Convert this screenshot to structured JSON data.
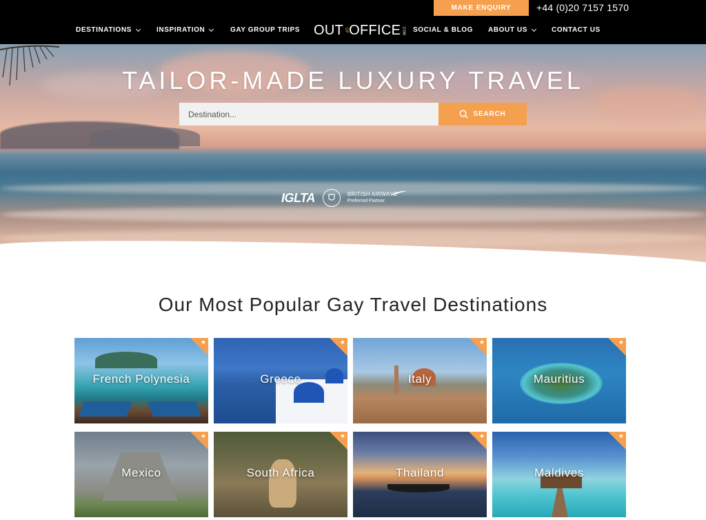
{
  "topbar": {
    "enquiry_label": "MAKE ENQUIRY",
    "phone": "+44 (0)20 7157 1570"
  },
  "nav": {
    "items": [
      {
        "label": "DESTINATIONS",
        "dropdown": true
      },
      {
        "label": "INSPIRATION",
        "dropdown": true
      },
      {
        "label": "GAY GROUP TRIPS",
        "dropdown": false
      },
      {
        "label": "SOCIAL & BLOG",
        "dropdown": false
      },
      {
        "label": "ABOUT US",
        "dropdown": true
      },
      {
        "label": "CONTACT US",
        "dropdown": false
      }
    ],
    "logo": {
      "left": "OUT",
      "middle": "OF",
      "right": "OFFICE",
      "suffix": ".COM"
    }
  },
  "hero": {
    "title": "TAILOR-MADE LUXURY TRAVEL",
    "search": {
      "placeholder": "Destination...",
      "button_label": "SEARCH",
      "button_icon": "search-icon"
    },
    "partners": {
      "iglta": "IGLTA",
      "ba_name": "BRITISH AIRWAYS",
      "ba_sub": "Preferred Partner"
    }
  },
  "section": {
    "title": "Our Most Popular Gay Travel Destinations"
  },
  "destinations": [
    {
      "name": "French Polynesia"
    },
    {
      "name": "Greece"
    },
    {
      "name": "Italy"
    },
    {
      "name": "Mauritius"
    },
    {
      "name": "Mexico"
    },
    {
      "name": "South Africa"
    },
    {
      "name": "Thailand"
    },
    {
      "name": "Maldives"
    }
  ],
  "colors": {
    "accent": "#f5a04e",
    "nav_bg": "#000000",
    "text": "#222222"
  }
}
